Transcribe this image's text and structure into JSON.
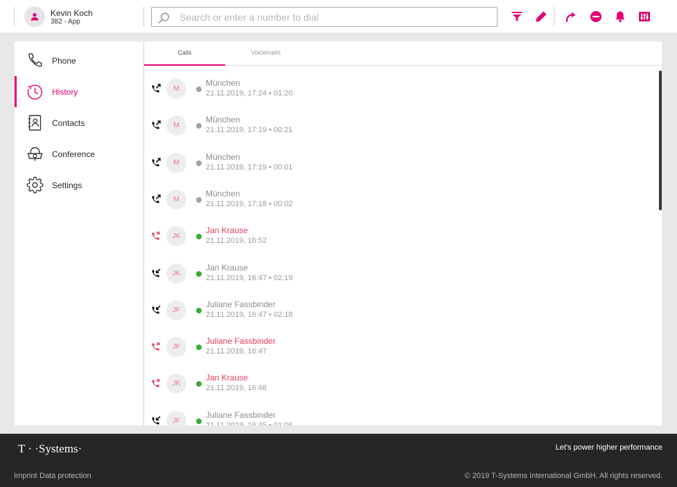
{
  "header": {
    "user_name": "Kevin Koch",
    "user_ext": "382 - App",
    "search_placeholder": "Search or enter a number to dial",
    "icons": [
      "filter-icon",
      "edit-icon",
      "forward-icon",
      "dnd-icon",
      "bell-icon",
      "equalizer-icon"
    ]
  },
  "colors": {
    "accent": "#e20074",
    "missed": "#e33a5e",
    "online": "#3aaa35",
    "offline": "#a0a0a0"
  },
  "sidebar": {
    "items": [
      {
        "label": "Phone",
        "icon": "phone-icon",
        "active": false
      },
      {
        "label": "History",
        "icon": "history-icon",
        "active": true
      },
      {
        "label": "Contacts",
        "icon": "contacts-icon",
        "active": false
      },
      {
        "label": "Conference",
        "icon": "conference-icon",
        "active": false
      },
      {
        "label": "Settings",
        "icon": "settings-icon",
        "active": false
      }
    ]
  },
  "tabs": [
    {
      "label": "Calls",
      "active": true
    },
    {
      "label": "Voicemails",
      "active": false
    }
  ],
  "calls": [
    {
      "initials": "M",
      "name": "München",
      "meta": "21.11.2019, 17:24 • 01:20",
      "type": "outgoing",
      "status": "offline"
    },
    {
      "initials": "M",
      "name": "München",
      "meta": "21.11.2019, 17:19 • 00:21",
      "type": "outgoing",
      "status": "offline"
    },
    {
      "initials": "M",
      "name": "München",
      "meta": "21.11.2019, 17:19 • 00:01",
      "type": "outgoing",
      "status": "offline"
    },
    {
      "initials": "M",
      "name": "München",
      "meta": "21.11.2019, 17:18 • 00:02",
      "type": "outgoing",
      "status": "offline"
    },
    {
      "initials": "JK",
      "name": "Jan Krause",
      "meta": "21.11.2019, 16:52",
      "type": "missed",
      "status": "online"
    },
    {
      "initials": "JK",
      "name": "Jan Krause",
      "meta": "21.11.2019, 16:47 • 02:19",
      "type": "incoming",
      "status": "online"
    },
    {
      "initials": "JF",
      "name": "Juliane Fassbinder",
      "meta": "21.11.2019, 16:47 • 02:18",
      "type": "incoming",
      "status": "online"
    },
    {
      "initials": "JF",
      "name": "Juliane Fassbinder",
      "meta": "21.11.2019, 16:47",
      "type": "missed",
      "status": "online"
    },
    {
      "initials": "JK",
      "name": "Jan Krause",
      "meta": "21.11.2019, 16:46",
      "type": "missed",
      "status": "online"
    },
    {
      "initials": "JF",
      "name": "Juliane Fassbinder",
      "meta": "21.11.2019, 16:45 • 01:06",
      "type": "incoming",
      "status": "online"
    }
  ],
  "footer": {
    "logo": "T · ·Systems·",
    "tagline": "Let's power higher performance",
    "imprint": "Imprint",
    "data_protection": "Data protection",
    "copyright": "© 2019 T-Systems International GmbH. All rights reserved."
  }
}
